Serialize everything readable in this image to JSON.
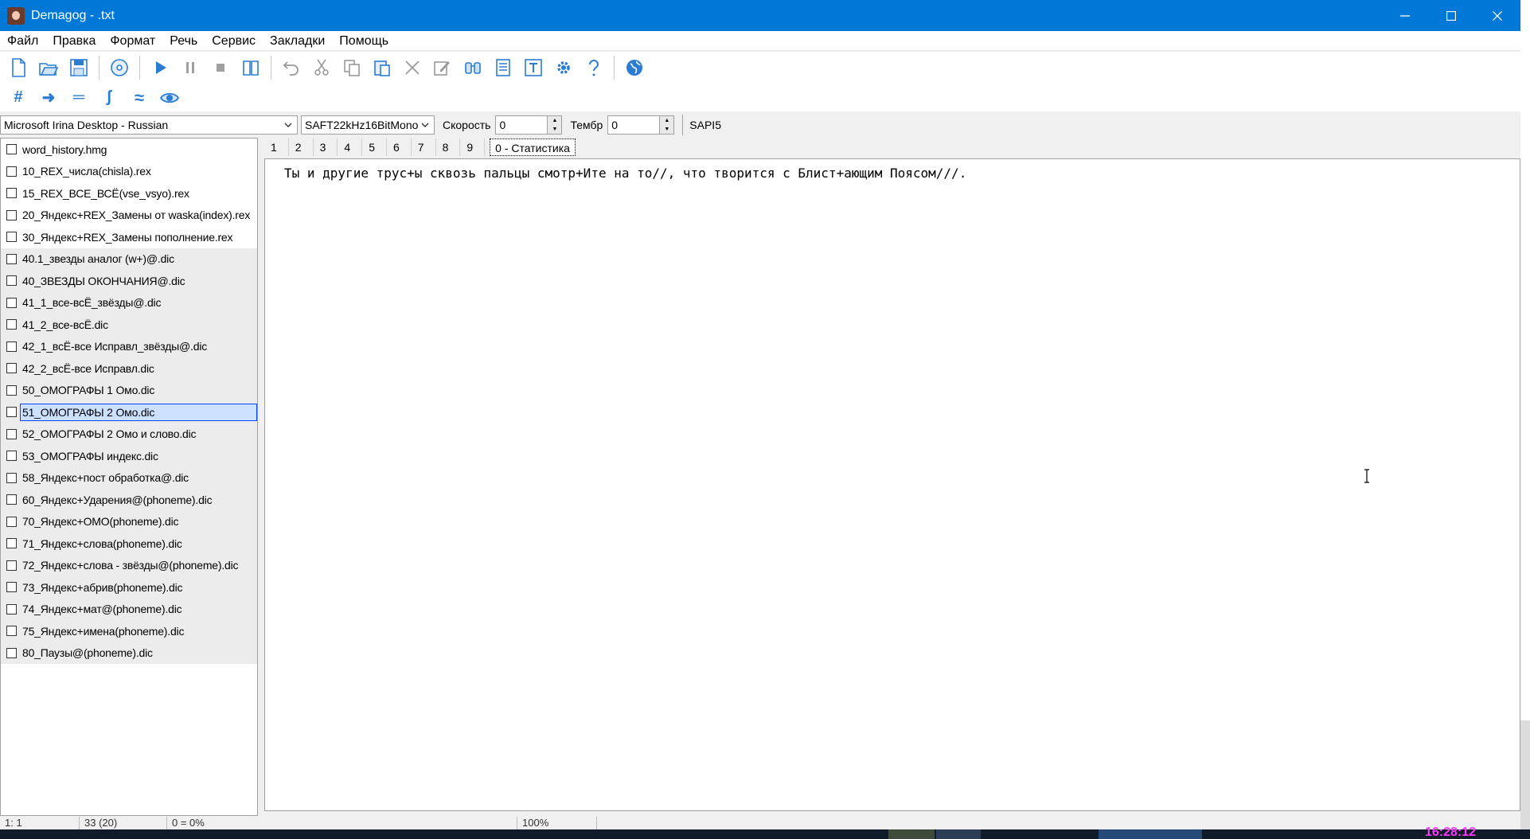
{
  "window": {
    "title": "Demagog - .txt"
  },
  "menu": [
    "Файл",
    "Правка",
    "Формат",
    "Речь",
    "Сервис",
    "Закладки",
    "Помощь"
  ],
  "toolbar1_icons": [
    "new-file-icon",
    "open-folder-icon",
    "save-icon",
    "disc-icon",
    "play-icon",
    "pause-icon",
    "stop-icon",
    "book-icon",
    "undo-icon",
    "cut-icon",
    "copy-icon",
    "paste-icon",
    "delete-icon",
    "edit-icon",
    "find-icon",
    "list-icon",
    "text-icon",
    "gear-icon",
    "help-icon",
    "globe-icon"
  ],
  "toolbar2": {
    "hash": "#",
    "arrow": "➜",
    "equals": "═",
    "integral": "ʃ",
    "approx": "≈"
  },
  "voice": {
    "engine": "Microsoft Irina Desktop - Russian",
    "format": "SAFT22kHz16BitMono",
    "speed_label": "Скорость",
    "speed_value": "0",
    "timbre_label": "Тембр",
    "timbre_value": "0",
    "api": "SAPI5"
  },
  "dictionaries": [
    {
      "label": "word_history.hmg"
    },
    {
      "label": "10_REX_числа(chisla).rex"
    },
    {
      "label": "15_REX_ВСЕ_ВСЁ(vse_vsyo).rex"
    },
    {
      "label": "20_Яндекс+REX_Замены от waska(index).rex"
    },
    {
      "label": "30_Яндекс+REX_Замены пополнение.rex"
    },
    {
      "label": "40.1_звезды аналог (w+)@.dic"
    },
    {
      "label": "40_ЗВЕЗДЫ ОКОНЧАНИЯ@.dic"
    },
    {
      "label": "41_1_все-всЁ_звёзды@.dic"
    },
    {
      "label": "41_2_все-всЁ.dic"
    },
    {
      "label": "42_1_всЁ-все Исправл_звёзды@.dic"
    },
    {
      "label": "42_2_всЁ-все Исправл.dic"
    },
    {
      "label": "50_ОМОГРАФЫ 1 Омо.dic"
    },
    {
      "label": "51_ОМОГРАФЫ 2 Омо.dic"
    },
    {
      "label": "52_ОМОГРАФЫ 2 Омо и слово.dic"
    },
    {
      "label": "53_ОМОГРАФЫ индекс.dic"
    },
    {
      "label": "58_Яндекс+пост обработка@.dic"
    },
    {
      "label": "60_Яндекс+Ударения@(phoneme).dic"
    },
    {
      "label": "70_Яндекс+ОМО(phoneme).dic"
    },
    {
      "label": "71_Яндекс+слова(phoneme).dic"
    },
    {
      "label": "72_Яндекс+слова - звёзды@(phoneme).dic"
    },
    {
      "label": "73_Яндекс+абрив(phoneme).dic"
    },
    {
      "label": "74_Яндекс+мат@(phoneme).dic"
    },
    {
      "label": "75_Яндекс+имена(phoneme).dic"
    },
    {
      "label": "80_Паузы@(phoneme).dic"
    }
  ],
  "selected_dictionary": "51_ОМОГРАФЫ 2 Омо.dic",
  "tabs": [
    "1",
    "2",
    "3",
    "4",
    "5",
    "6",
    "7",
    "8",
    "9",
    "0 - Статистика"
  ],
  "active_tab": "0 - Статистика",
  "editor_text": "Ты и другие трус+ы сквозь пальцы смотр+Ите на то//, что творится с Блист+ающим Поясом///.",
  "status": {
    "position": "1: 1",
    "count": "33 (20)",
    "percent": "0 = 0%",
    "zoom": "100%"
  },
  "clock": "16:28:12",
  "colors": {
    "titlebar": "#0078d7",
    "selection": "#cce0ff",
    "selection_border": "#0047ff",
    "clock": "#ff38ff"
  }
}
